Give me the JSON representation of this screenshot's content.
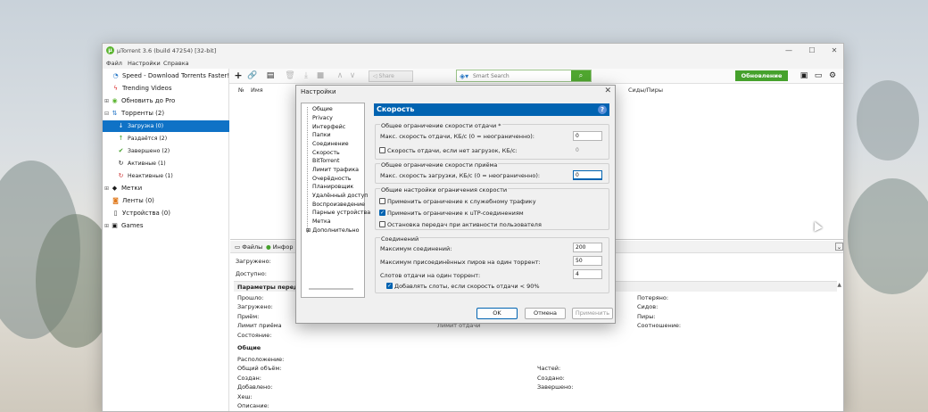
{
  "window": {
    "title": "µTorrent 3.6  (build 47254) [32-bit]",
    "controls": {
      "minimize": "—",
      "maximize": "☐",
      "close": "✕"
    }
  },
  "menu": [
    "Файл",
    "Настройки",
    "Справка"
  ],
  "toolbar": {
    "share_label": "Share",
    "search_placeholder": "Smart Search",
    "update_label": "Обновление"
  },
  "sidebar": {
    "items": [
      {
        "label": "Speed - Download Torrents Faster!",
        "icon": "speed-icon"
      },
      {
        "label": "Trending Videos",
        "icon": "lightning-icon"
      },
      {
        "label": "Обновить до Pro",
        "icon": "pro-icon"
      },
      {
        "label": "Торренты (2)",
        "icon": "torrents-icon"
      },
      {
        "label": "Загрузка (0)",
        "icon": "download-icon"
      },
      {
        "label": "Раздаётся (2)",
        "icon": "seeding-icon"
      },
      {
        "label": "Завершено (2)",
        "icon": "completed-icon"
      },
      {
        "label": "Активные (1)",
        "icon": "active-icon"
      },
      {
        "label": "Неактивные (1)",
        "icon": "inactive-icon"
      },
      {
        "label": "Метки",
        "icon": "labels-icon"
      },
      {
        "label": "Ленты (0)",
        "icon": "rss-icon"
      },
      {
        "label": "Устройства (0)",
        "icon": "devices-icon"
      },
      {
        "label": "Games",
        "icon": "games-icon"
      }
    ]
  },
  "list": {
    "columns": {
      "num": "№",
      "name": "Имя",
      "seeds": "Сиды/Пиры"
    }
  },
  "details": {
    "tabs": {
      "files": "Файлы",
      "info": "Инфор"
    },
    "top": {
      "downloaded": "Загружено:",
      "available": "Доступно:"
    },
    "transfer": {
      "header": "Параметры передач",
      "left": [
        "Прошло:",
        "Загружено:",
        "Приём:",
        "Лимит приёма",
        "Состояние:"
      ],
      "right": [
        "Потеряно:",
        "Сидов:",
        "Пиры:",
        "Соотношение:"
      ],
      "partial": "Лимит отдачи"
    },
    "general": {
      "header": "Общие",
      "left": [
        "Расположение:",
        "Общий объём:",
        "Создан:",
        "Добавлено:",
        "Хеш:",
        "Описание:"
      ],
      "mid": [
        "Частей:",
        "Создано:",
        "Завершено:"
      ]
    }
  },
  "dialog": {
    "title": "Настройки",
    "tree": [
      "Общие",
      "Privacy",
      "Интерфейс",
      "Папки",
      "Соединение",
      "Скорость",
      "BitTorrent",
      "Лимит трафика",
      "Очерёдность",
      "Планировщик",
      "Удалённый доступ",
      "Воспроизведение",
      "Парные устройства",
      "Метка",
      "Дополнительно"
    ],
    "panel_title": "Скорость",
    "upload": {
      "group": "Общее ограничение скорости отдачи *",
      "max_label": "Макс. скорость отдачи, КБ/с (0 = неограниченно):",
      "max_value": "0",
      "nodl_label": "Скорость отдачи, если нет загрузок, КБ/с:",
      "nodl_value": "0"
    },
    "download": {
      "group": "Общее ограничение скорости приёма",
      "max_label": "Макс. скорость загрузки, КБ/с (0 = неограниченно):",
      "max_value": "0"
    },
    "global": {
      "group": "Общие настройки ограничения скорости",
      "overhead": "Применить ограничение к служебному трафику",
      "utp": "Применить ограничение к uTP-соединениям",
      "stop": "Остановка передач при активности пользователя"
    },
    "connections": {
      "group": "Соединений",
      "max_label": "Максимум соединений:",
      "max_value": "200",
      "peers_label": "Максимум присоединённых пиров на один торрент:",
      "peers_value": "50",
      "slots_label": "Слотов отдачи на один торрент:",
      "slots_value": "4",
      "extra_label": "Добавлять слоты, если скорость отдачи < 90%"
    },
    "buttons": {
      "ok": "OK",
      "cancel": "Отмена",
      "apply": "Применить"
    }
  }
}
